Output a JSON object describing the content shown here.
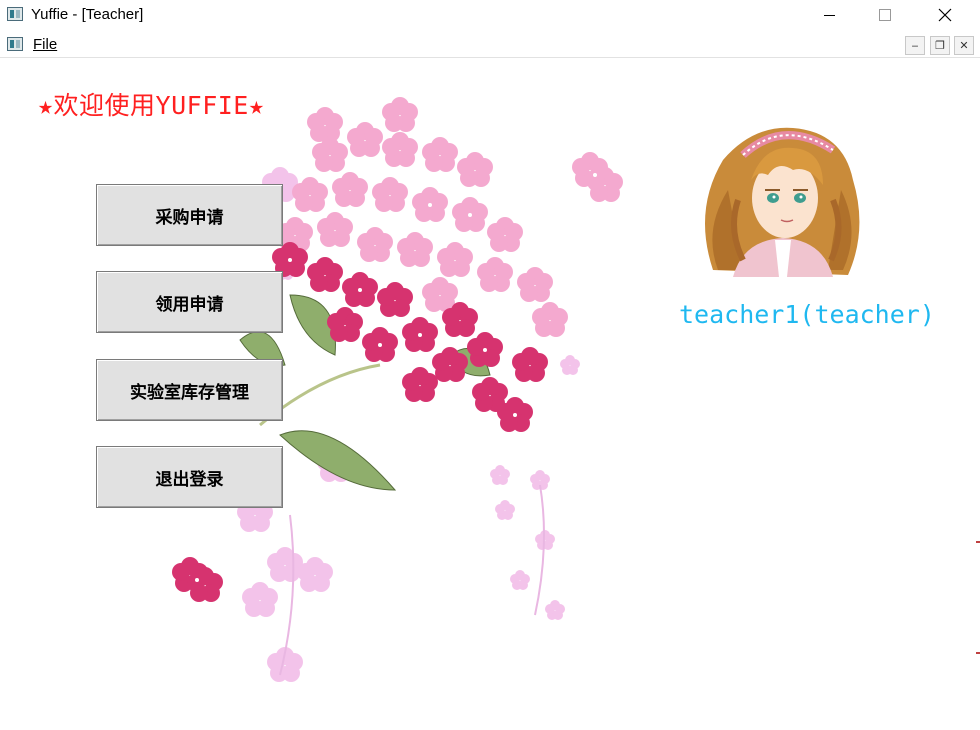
{
  "window": {
    "title": "Yuffie - [Teacher]",
    "minimize_glyph": "",
    "close_glyph": "✕"
  },
  "menubar": {
    "file_label": "File",
    "mdi_minimize": "‒",
    "mdi_restore": "❐",
    "mdi_close": "✕"
  },
  "main": {
    "welcome_text": "★欢迎使用YUFFIE★",
    "buttons": [
      {
        "label": "采购申请"
      },
      {
        "label": "领用申请"
      },
      {
        "label": "实验室库存管理"
      },
      {
        "label": "退出登录"
      }
    ],
    "user_label": "teacher1(teacher)"
  },
  "colors": {
    "welcome": "#ff2020",
    "user_label": "#1fb8f0",
    "button_bg": "#e1e1e1"
  },
  "icons": [
    "app-icon",
    "flower-bouquet-image",
    "teacher-avatar-image"
  ]
}
